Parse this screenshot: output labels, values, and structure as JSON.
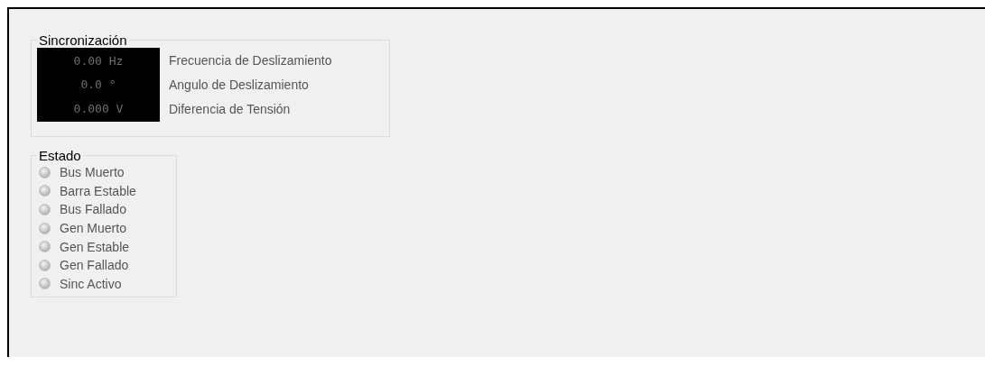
{
  "sync": {
    "title": "Sincronización",
    "readings": [
      {
        "value": "0.00 Hz",
        "label": "Frecuencia de Deslizamiento"
      },
      {
        "value": "0.0 °",
        "label": "Angulo de Deslizamiento"
      },
      {
        "value": "0.000 V",
        "label": "Diferencia de Tensión"
      }
    ]
  },
  "status": {
    "title": "Estado",
    "indicators": [
      {
        "label": "Bus Muerto",
        "on": false
      },
      {
        "label": "Barra Estable",
        "on": false
      },
      {
        "label": "Bus Fallado",
        "on": false
      },
      {
        "label": "Gen Muerto",
        "on": false
      },
      {
        "label": "Gen Estable",
        "on": false
      },
      {
        "label": "Gen Fallado",
        "on": false
      },
      {
        "label": "Sinc Activo",
        "on": false
      }
    ]
  }
}
